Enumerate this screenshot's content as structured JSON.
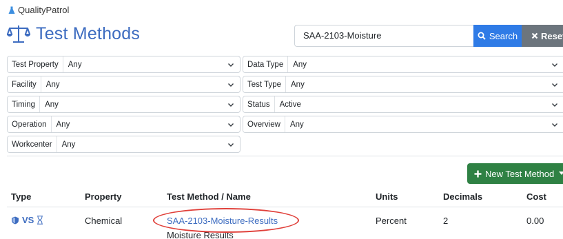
{
  "app": {
    "name": "QualityPatrol"
  },
  "page": {
    "title": "Test Methods"
  },
  "search": {
    "value": "SAA-2103-Moisture",
    "search_label": "Search",
    "reset_label": "Reset"
  },
  "filters": [
    {
      "label": "Test Property",
      "value": "Any"
    },
    {
      "label": "Data Type",
      "value": "Any"
    },
    {
      "label": "Facility",
      "value": "Any"
    },
    {
      "label": "Test Type",
      "value": "Any"
    },
    {
      "label": "Timing",
      "value": "Any"
    },
    {
      "label": "Status",
      "value": "Active"
    },
    {
      "label": "Operation",
      "value": "Any"
    },
    {
      "label": "Overview",
      "value": "Any"
    },
    {
      "label": "Workcenter",
      "value": "Any"
    }
  ],
  "actions": {
    "new_test_method_label": "New Test Method"
  },
  "table": {
    "headers": [
      "Type",
      "Property",
      "Test Method / Name",
      "Units",
      "Decimals",
      "Cost"
    ],
    "rows": [
      {
        "type_badge": "VS",
        "type_icons": [
          "shield-icon",
          "hourglass-icon"
        ],
        "property": "Chemical",
        "method": "SAA-2103-Moisture-Results",
        "name": "Moisture Results",
        "units": "Percent",
        "decimals": "2",
        "cost": "0.00"
      }
    ]
  },
  "colors": {
    "accent": "#3d6cc0",
    "search_button": "#2f7be6",
    "reset_button": "#6c757d",
    "new_button": "#2f8144",
    "annotation_ellipse": "#e0403a"
  }
}
